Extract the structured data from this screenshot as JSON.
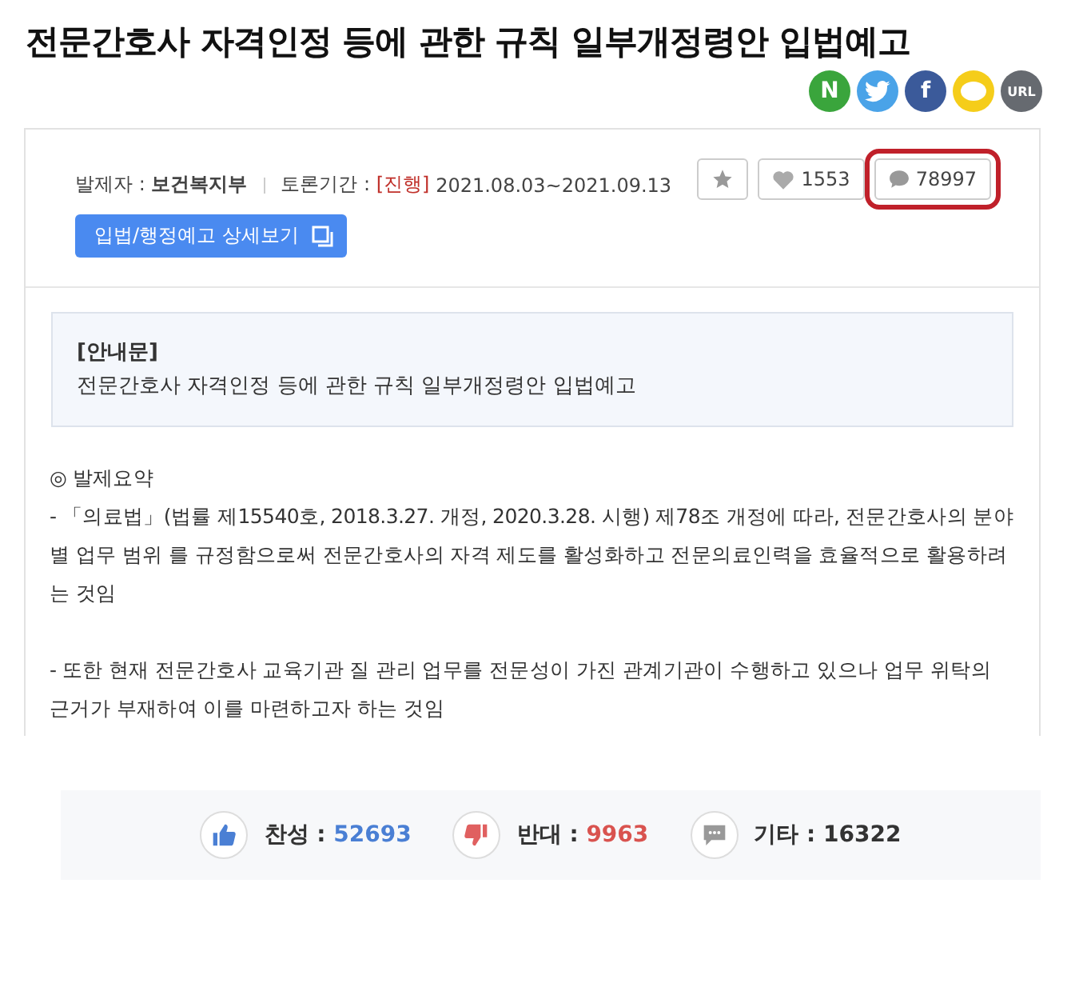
{
  "title": "전문간호사 자격인정 등에 관한 규칙 일부개정령안 입법예고",
  "share": [
    {
      "kind": "naver",
      "label": "N",
      "color": "#3aa53c"
    },
    {
      "kind": "twitter",
      "color": "#4aa3e8"
    },
    {
      "kind": "facebook",
      "label": "f",
      "color": "#3b5a9a"
    },
    {
      "kind": "kakao",
      "color": "#f5cd1a"
    },
    {
      "kind": "url",
      "label": "URL",
      "color": "#666a70"
    }
  ],
  "meta": {
    "proposer_label": "발제자 :",
    "proposer": "보건복지부",
    "period_label": "토론기간 :",
    "status": "[진행]",
    "period": "2021.08.03~2021.09.13"
  },
  "detail_button": "입법/행정예고 상세보기",
  "actions": [
    {
      "kind": "star",
      "highlighted": false
    },
    {
      "kind": "like",
      "count": "1553",
      "highlighted": false
    },
    {
      "kind": "comment",
      "count": "78997",
      "highlighted": true
    }
  ],
  "notice": {
    "heading": "[안내문]",
    "text": "전문간호사 자격인정 등에 관한 규칙 일부개정령안 입법예고"
  },
  "summary": {
    "heading": "◎ 발제요약",
    "paragraphs": [
      "- 「의료법」(법률 제15540호, 2018.3.27. 개정, 2020.3.28. 시행) 제78조 개정에 따라, 전문간호사의 분야별 업무 범위 를 규정함으로써 전문간호사의 자격 제도를 활성화하고 전문의료인력을 효율적으로 활용하려는 것임",
      "- 또한 현재 전문간호사 교육기관 질 관리 업무를 전문성이 가진 관계기관이 수행하고 있으나 업무 위탁의 근거가 부재하여 이를 마련하고자 하는 것임"
    ]
  },
  "votes": [
    {
      "kind": "agree",
      "label": "찬성 :",
      "count": "52693",
      "color": "#4a7fd4"
    },
    {
      "kind": "oppose",
      "label": "반대 :",
      "count": "9963",
      "color": "#d9534f"
    },
    {
      "kind": "other",
      "label": "기타 :",
      "count": "16322",
      "color": "#333333"
    }
  ]
}
